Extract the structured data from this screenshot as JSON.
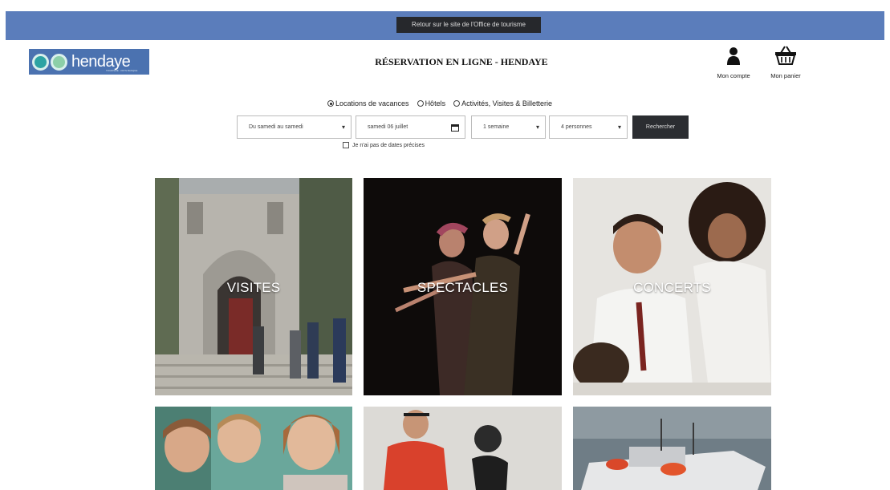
{
  "banner": {
    "back_label": "Retour sur le site de l'Office de tourisme"
  },
  "logo": {
    "text": "hendaye",
    "tagline": "TOURISME · PAYS BASQUE"
  },
  "header": {
    "title": "RÉSERVATION EN LIGNE - HENDAYE",
    "account_label": "Mon compte",
    "cart_label": "Mon panier"
  },
  "search": {
    "categories": [
      {
        "label": "Locations de vacances",
        "selected": true
      },
      {
        "label": "Hôtels",
        "selected": false
      },
      {
        "label": "Activités, Visites & Billetterie",
        "selected": false
      }
    ],
    "stay_type": "Du samedi au samedi",
    "arrival_date": "samedi 06 juillet",
    "duration": "1 semaine",
    "guests": "4 personnes",
    "submit_label": "Rechercher",
    "no_dates_label": "Je n'ai pas de dates précises"
  },
  "tiles": [
    {
      "label": "VISITES"
    },
    {
      "label": "SPECTACLES"
    },
    {
      "label": "CONCERTS"
    },
    {
      "label": ""
    },
    {
      "label": ""
    },
    {
      "label": ""
    }
  ],
  "icons": {
    "account": "user-icon",
    "cart": "basket-icon",
    "calendar": "calendar-icon",
    "dropdown": "chevron-down-icon"
  },
  "colors": {
    "banner": "#5b7dbb",
    "logo_bg": "#4b72b0",
    "button_dark": "#2b2d31"
  }
}
